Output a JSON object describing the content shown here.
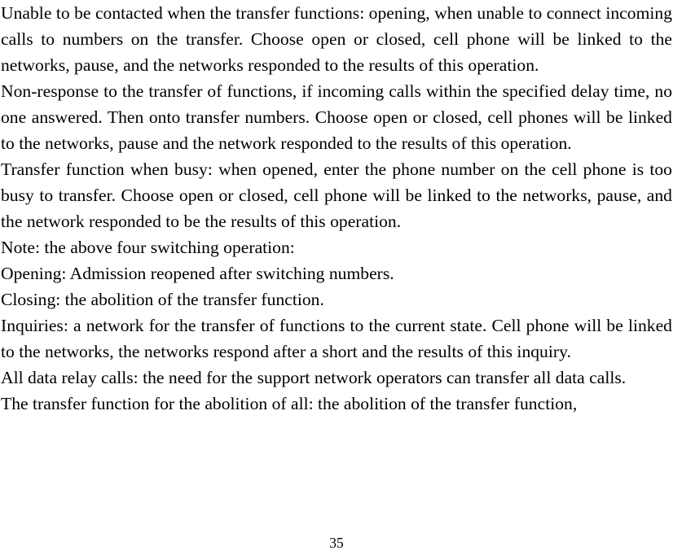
{
  "document": {
    "page_number": "35",
    "paragraphs": [
      {
        "id": "p1",
        "text": "Unable to be contacted when the transfer functions: opening, when unable to connect incoming calls to numbers on the transfer. Choose open or closed, cell phone will be linked to the networks, pause, and the networks responded to the results of this operation."
      },
      {
        "id": "p2",
        "text": "Non-response to the transfer of functions, if incoming calls within the specified delay time, no one answered. Then onto transfer numbers. Choose open or closed, cell phones will be linked to the networks, pause and the network responded to the results of this operation."
      },
      {
        "id": "p3",
        "text": "Transfer function when busy: when opened, enter the phone number on the cell phone is too busy to transfer. Choose open or closed, cell phone will be linked to the networks, pause, and the network responded to be the results of this operation."
      },
      {
        "id": "p4",
        "text": "Note: the above four switching operation:"
      },
      {
        "id": "p5",
        "text": "Opening: Admission reopened after switching numbers."
      },
      {
        "id": "p6",
        "text": "Closing: the abolition of the transfer function."
      },
      {
        "id": "p7",
        "text": "Inquiries: a network for the transfer of functions to the current state. Cell phone will be linked to the networks, the networks respond after a short and the results of this inquiry."
      },
      {
        "id": "p8",
        "text": "All data relay calls: the need for the support network operators can transfer all data calls."
      },
      {
        "id": "p9",
        "text": "The transfer function for the abolition of all: the abolition of the transfer function,"
      }
    ]
  }
}
